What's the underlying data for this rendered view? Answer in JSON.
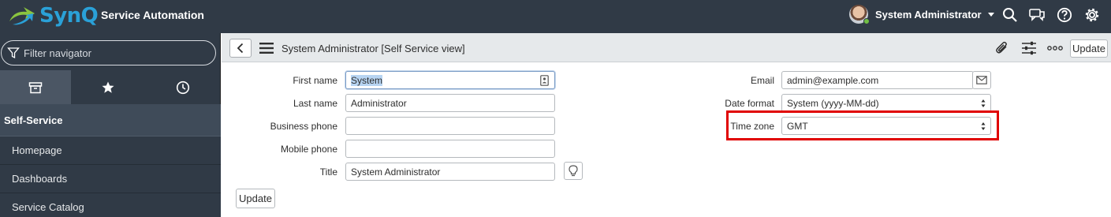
{
  "banner": {
    "logo_text": "SynQ",
    "app_title": "Service Automation",
    "user_name": "System Administrator",
    "icons": [
      "search-icon",
      "chat-icon",
      "help-icon",
      "gear-icon"
    ]
  },
  "navigator": {
    "filter_placeholder": "Filter navigator",
    "tabs": [
      "all-apps-icon",
      "favorites-star-icon",
      "history-clock-icon"
    ],
    "section": "Self-Service",
    "modules": [
      "Homepage",
      "Dashboards",
      "Service Catalog"
    ]
  },
  "form_header": {
    "title": "System Administrator [Self Service view]",
    "update_label": "Update",
    "icons": [
      "attachment-icon",
      "personalize-sliders-icon",
      "more-options-icon"
    ]
  },
  "form": {
    "left_fields": [
      {
        "label": "First name",
        "value": "System"
      },
      {
        "label": "Last name",
        "value": "Administrator"
      },
      {
        "label": "Business phone",
        "value": ""
      },
      {
        "label": "Mobile phone",
        "value": ""
      },
      {
        "label": "Title",
        "value": "System Administrator"
      }
    ],
    "right_fields": [
      {
        "label": "Email",
        "value": "admin@example.com"
      },
      {
        "label": "Date format",
        "value": "System (yyyy-MM-dd)"
      },
      {
        "label": "Time zone",
        "value": "GMT"
      }
    ],
    "update_label": "Update"
  },
  "colors": {
    "banner_bg": "#303a46",
    "logo_blue": "#2aa1d8",
    "highlight_red": "#e00000",
    "header_bg": "#e6e9eb"
  }
}
